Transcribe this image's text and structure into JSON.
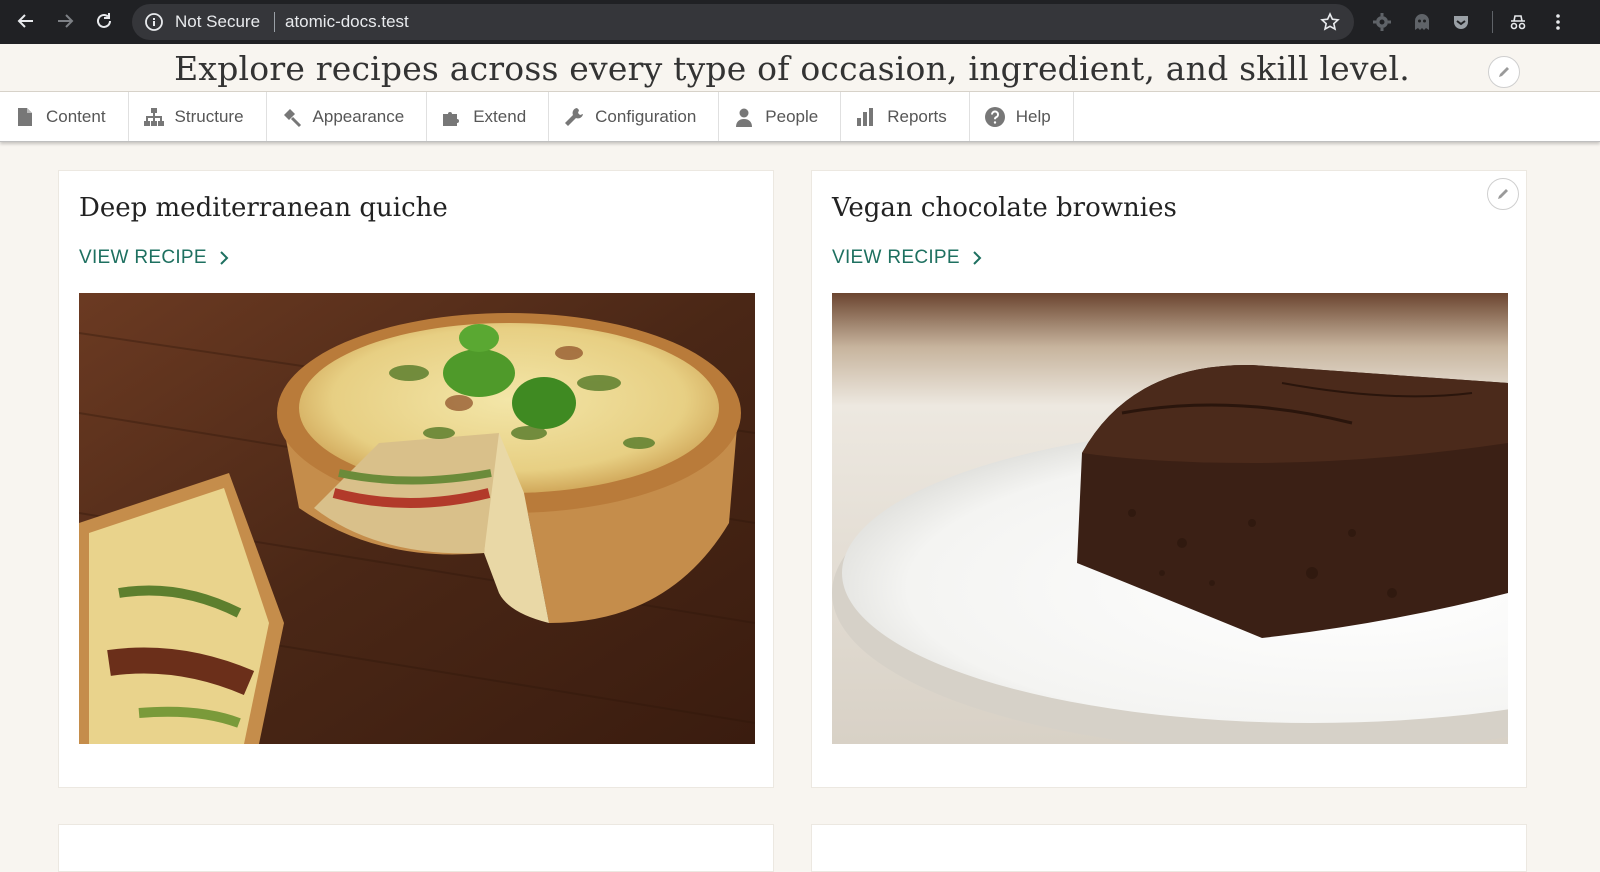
{
  "browser": {
    "security_label": "Not Secure",
    "url": "atomic-docs.test"
  },
  "banner": {
    "text": "Explore recipes across every type of occasion, ingredient, and skill level."
  },
  "toolbar": {
    "items": [
      {
        "label": "Content",
        "icon": "file-icon"
      },
      {
        "label": "Structure",
        "icon": "sitemap-icon"
      },
      {
        "label": "Appearance",
        "icon": "paintbrush-icon"
      },
      {
        "label": "Extend",
        "icon": "puzzle-icon"
      },
      {
        "label": "Configuration",
        "icon": "wrench-icon"
      },
      {
        "label": "People",
        "icon": "person-icon"
      },
      {
        "label": "Reports",
        "icon": "bar-chart-icon"
      },
      {
        "label": "Help",
        "icon": "question-icon"
      }
    ]
  },
  "cards": [
    {
      "title": "Deep mediterranean quiche",
      "link": "VIEW RECIPE",
      "image": "quiche-photo"
    },
    {
      "title": "Vegan chocolate brownies",
      "link": "VIEW RECIPE",
      "image": "brownie-photo"
    }
  ],
  "colors": {
    "link": "#1e7060",
    "page_bg": "#f8f5f0",
    "chrome_bg": "#202124"
  }
}
